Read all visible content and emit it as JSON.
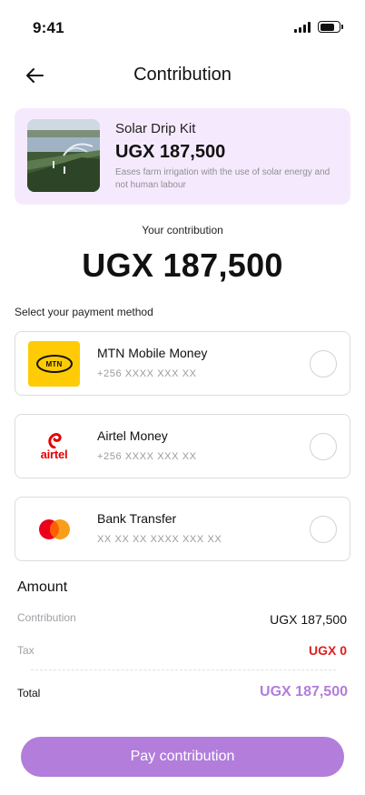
{
  "status_bar": {
    "time": "9:41"
  },
  "header": {
    "title": "Contribution"
  },
  "product": {
    "name": "Solar Drip Kit",
    "price": "UGX 187,500",
    "description": "Eases farm irrigation with the use of solar energy and not human labour"
  },
  "contribution": {
    "label": "Your contribution",
    "amount": "UGX 187,500"
  },
  "payment": {
    "section_label": "Select your payment method",
    "methods": [
      {
        "name": "MTN Mobile Money",
        "detail": "+256 XXXX XXX XX",
        "logo_text": "MTN",
        "icon": "mtn-logo"
      },
      {
        "name": "Airtel Money",
        "detail": "+256 XXXX XXX XX",
        "logo_text": "airtel",
        "icon": "airtel-logo"
      },
      {
        "name": "Bank Transfer",
        "detail": "XX XX XX XXXX XXX XX",
        "icon": "mastercard-logo"
      }
    ]
  },
  "amount": {
    "title": "Amount",
    "contribution_label": "Contribution",
    "contribution_value": "UGX 187,500",
    "tax_label": "Tax",
    "tax_value": "UGX 0",
    "total_label": "Total",
    "total_value": "UGX 187,500"
  },
  "actions": {
    "pay_label": "Pay contribution"
  },
  "colors": {
    "accent": "#b27ddb",
    "card_bg": "#f5eafd",
    "tax": "#e01e1e",
    "mtn_yellow": "#ffcb05",
    "airtel_red": "#e40000"
  }
}
